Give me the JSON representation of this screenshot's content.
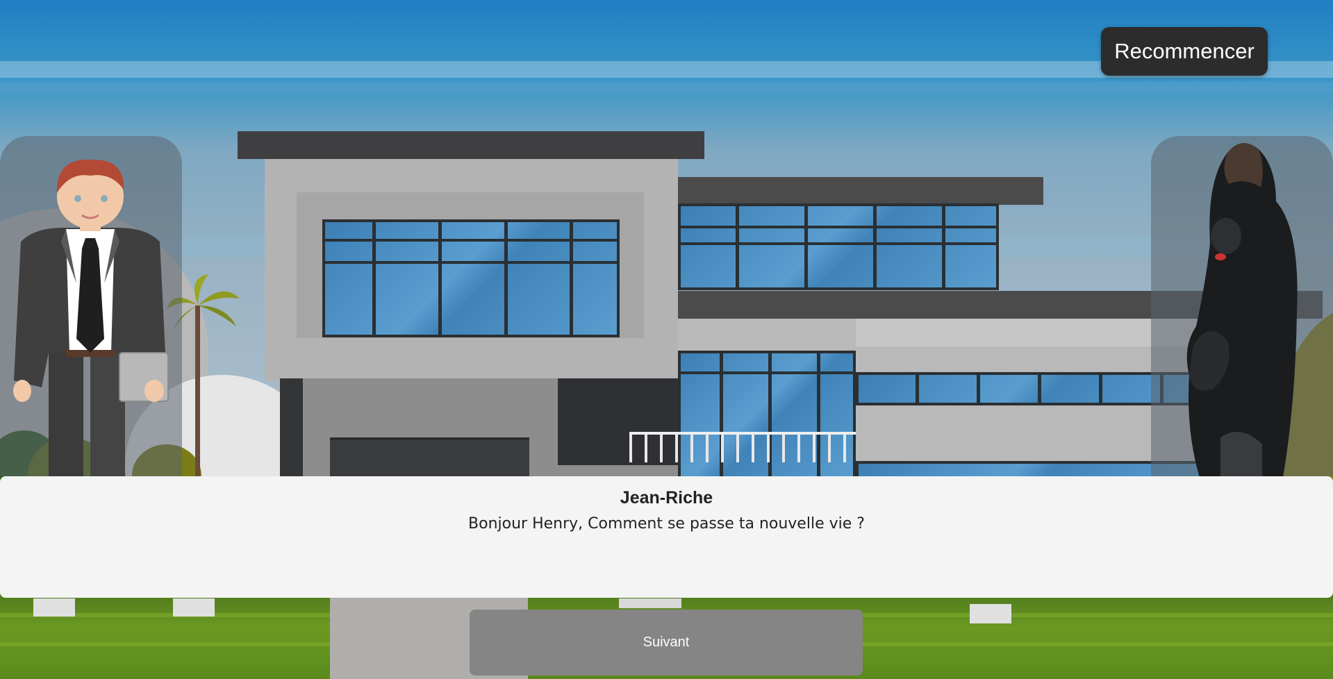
{
  "toolbar": {
    "restart_label": "Recommencer"
  },
  "dialogue": {
    "speaker": "Jean-Riche",
    "text": "Bonjour Henry, Comment se passe ta nouvelle vie ?",
    "next_label": "Suivant"
  },
  "characters": {
    "left": "businessman-character",
    "right": "gorilla-character"
  },
  "colors": {
    "restart_bg": "#2c2c2c",
    "dialogue_bg": "#f4f4f4",
    "next_bg": "#858585"
  }
}
